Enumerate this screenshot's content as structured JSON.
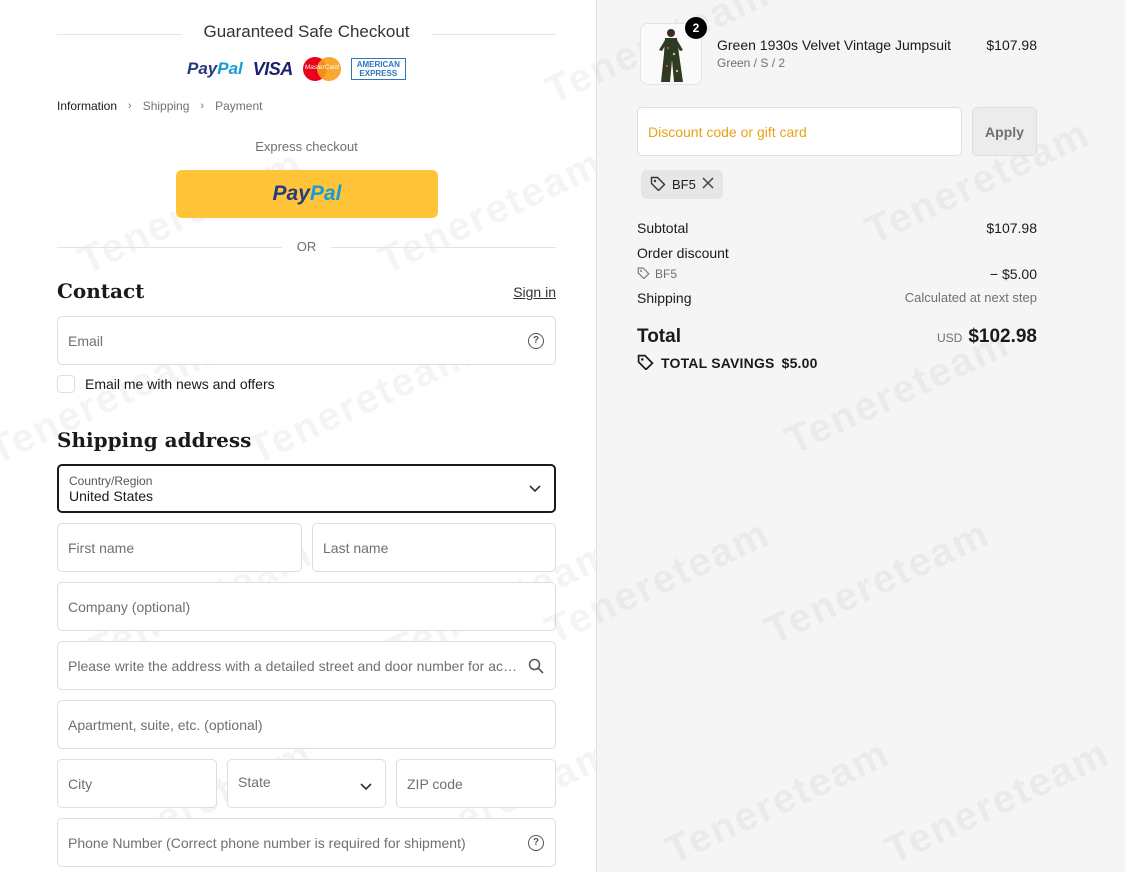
{
  "header": {
    "safe_checkout": "Guaranteed Safe Checkout",
    "logos": {
      "paypal_1": "Pay",
      "paypal_2": "Pal",
      "visa": "VISA",
      "mastercard": "MasterCard",
      "amex_1": "AMERICAN",
      "amex_2": "EXPRESS"
    }
  },
  "breadcrumb": {
    "items": [
      "Information",
      "Shipping",
      "Payment"
    ],
    "separator": "›"
  },
  "express": {
    "label": "Express checkout",
    "paypal_1": "Pay",
    "paypal_2": "Pal",
    "or": "OR"
  },
  "contact": {
    "title": "Contact",
    "sign_in": "Sign in",
    "email_placeholder": "Email",
    "newsletter_label": "Email me with news and offers"
  },
  "shipping": {
    "title": "Shipping address",
    "country_label": "Country/Region",
    "country_value": "United States",
    "first_name": "First name",
    "last_name": "Last name",
    "company": "Company (optional)",
    "address": "Please write the address with a detailed street and door number for accurate delivery",
    "apartment": "Apartment, suite, etc. (optional)",
    "city": "City",
    "state": "State",
    "zip": "ZIP code",
    "phone": "Phone Number (Correct phone number is required for shipment)"
  },
  "watermark": "Tenereteam",
  "summary": {
    "product": {
      "quantity": "2",
      "name": "Green 1930s Velvet Vintage Jumpsuit",
      "variant": "Green / S / 2",
      "price": "$107.98"
    },
    "discount_placeholder": "Discount code or gift card",
    "apply_label": "Apply",
    "applied_code": "BF5",
    "subtotal_label": "Subtotal",
    "subtotal_value": "$107.98",
    "order_discount_label": "Order discount",
    "order_discount_code": "BF5",
    "order_discount_value": "− $5.00",
    "shipping_label": "Shipping",
    "shipping_value": "Calculated at next step",
    "total_label": "Total",
    "currency": "USD",
    "total_value": "$102.98",
    "savings_label": "TOTAL SAVINGS",
    "savings_value": "$5.00"
  },
  "colors": {
    "paypal_yellow": "#ffc439",
    "placeholder_orange": "#e8a317",
    "summary_bg": "#f5f5f5"
  }
}
